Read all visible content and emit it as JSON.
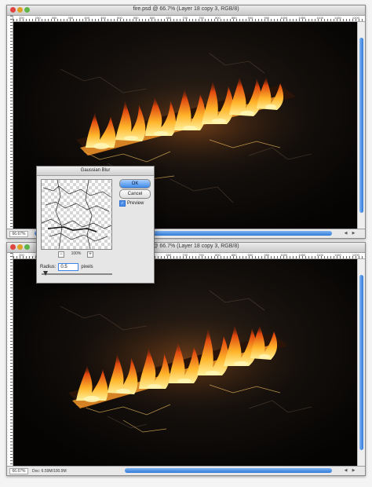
{
  "top_window": {
    "title": "fire.psd @ 66.7% (Layer 18 copy 3, RGB/8)",
    "zoom": "66.67%",
    "ruler_labels": [
      "200",
      "250",
      "300",
      "350",
      "400",
      "450",
      "500",
      "550",
      "600",
      "650",
      "700",
      "750",
      "800",
      "850",
      "900",
      "950",
      "1000",
      "1050",
      "1100",
      "1150",
      "1200"
    ]
  },
  "bottom_window": {
    "title": "fire.psd @ 66.7% (Layer 18 copy 3, RGB/8)",
    "zoom": "66.67%",
    "doc_info": "Doc: 6.59M/100.9M",
    "ruler_labels": [
      "200",
      "250",
      "300",
      "350",
      "400",
      "450",
      "500",
      "550",
      "600",
      "650",
      "700",
      "750",
      "800",
      "850",
      "900",
      "950",
      "1000",
      "1050",
      "1100",
      "1150",
      "1200"
    ]
  },
  "dialog": {
    "title": "Gaussian Blur",
    "ok_label": "OK",
    "cancel_label": "Cancel",
    "preview_label": "Preview",
    "preview_checked": true,
    "zoom_level": "100%",
    "radius_label": "Radius:",
    "radius_value": "0.5",
    "radius_unit": "pixels",
    "minus_glyph": "−",
    "plus_glyph": "+"
  },
  "colors": {
    "accent": "#3b86e8",
    "flame_core": "#ffe36a",
    "flame_mid": "#ff8a1a",
    "flame_edge": "#c4310a"
  }
}
